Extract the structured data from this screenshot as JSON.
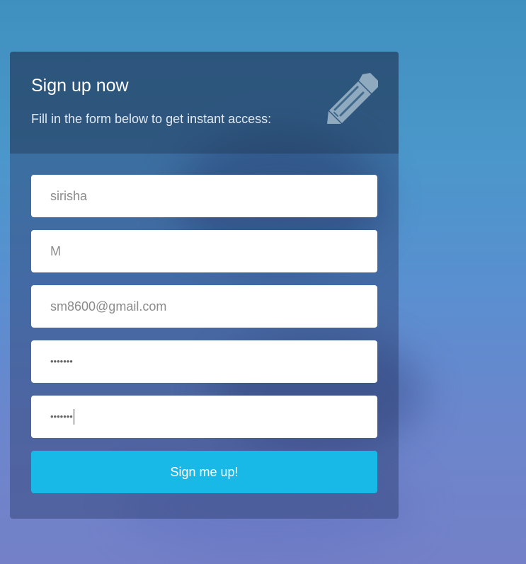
{
  "header": {
    "title": "Sign up now",
    "subtitle": "Fill in the form below to get instant access:",
    "icon": "pencil-icon"
  },
  "form": {
    "fields": [
      {
        "value": "sirisha"
      },
      {
        "value": "M"
      },
      {
        "value": "sm8600@gmail.com"
      },
      {
        "value": "•••••••"
      },
      {
        "value": "•••••••"
      }
    ],
    "submit_label": "Sign me up!"
  },
  "colors": {
    "button": "#19b9e7",
    "field_background": "#ffffff",
    "title_text": "#ffffff"
  }
}
